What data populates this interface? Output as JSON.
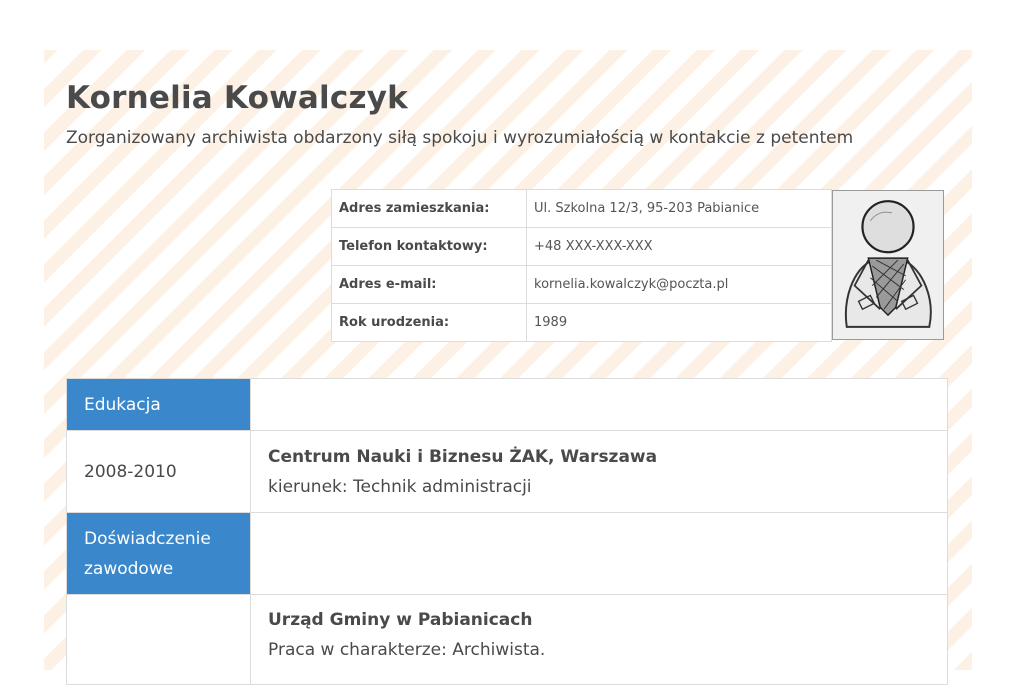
{
  "header": {
    "name": "Kornelia Kowalczyk",
    "tagline": "Zorganizowany archiwista obdarzony siłą spokoju i wyrozumiałością w kontakcie z petentem"
  },
  "info": [
    {
      "label": "Adres zamieszkania:",
      "value": "Ul. Szkolna 12/3, 95-203 Pabianice"
    },
    {
      "label": "Telefon kontaktowy:",
      "value": "+48 XXX-XXX-XXX"
    },
    {
      "label": "Adres e-mail:",
      "value": "kornelia.kowalczyk@poczta.pl"
    },
    {
      "label": "Rok urodzenia:",
      "value": "1989"
    }
  ],
  "photo": {
    "icon": "person-sketch-photo"
  },
  "education": {
    "heading": "Edukacja",
    "entries": [
      {
        "dates": "2008-2010",
        "title": "Centrum Nauki i Biznesu ŻAK, Warszawa",
        "detail": "kierunek: Technik administracji"
      }
    ]
  },
  "experience": {
    "heading_line1": "Doświadczenie",
    "heading_line2": "zawodowe",
    "entries": [
      {
        "dates": "",
        "title": "Urząd Gminy w Pabianicach",
        "detail": "Praca w charakterze: Archiwista."
      }
    ]
  },
  "colors": {
    "accent": "#3b87cb",
    "stripe": "#fdf0e4",
    "text": "#4a4a4a",
    "border": "#dcdcdc"
  }
}
